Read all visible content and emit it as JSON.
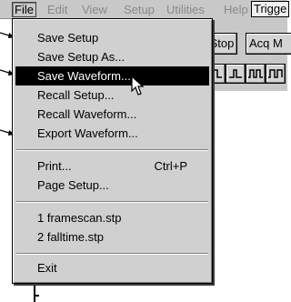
{
  "menubar": {
    "file": "File",
    "edit": "Edit",
    "view": "View",
    "setup": "Setup",
    "utilities": "Utilities",
    "help": "Help",
    "trigger": "Trigge"
  },
  "toolbar": {
    "stop": "/Stop",
    "acq": "Acq M"
  },
  "file_menu": {
    "items": [
      {
        "label": "Save Setup"
      },
      {
        "label": "Save Setup As..."
      },
      {
        "label": "Save Waveform...",
        "selected": true
      },
      {
        "label": "Recall Setup..."
      },
      {
        "label": "Recall Waveform..."
      },
      {
        "label": "Export Waveform..."
      },
      {
        "label": "Print...",
        "shortcut": "Ctrl+P"
      },
      {
        "label": "Page Setup..."
      },
      {
        "label": "1 framescan.stp"
      },
      {
        "label": "2 falltime.stp"
      },
      {
        "label": "Exit"
      }
    ]
  }
}
